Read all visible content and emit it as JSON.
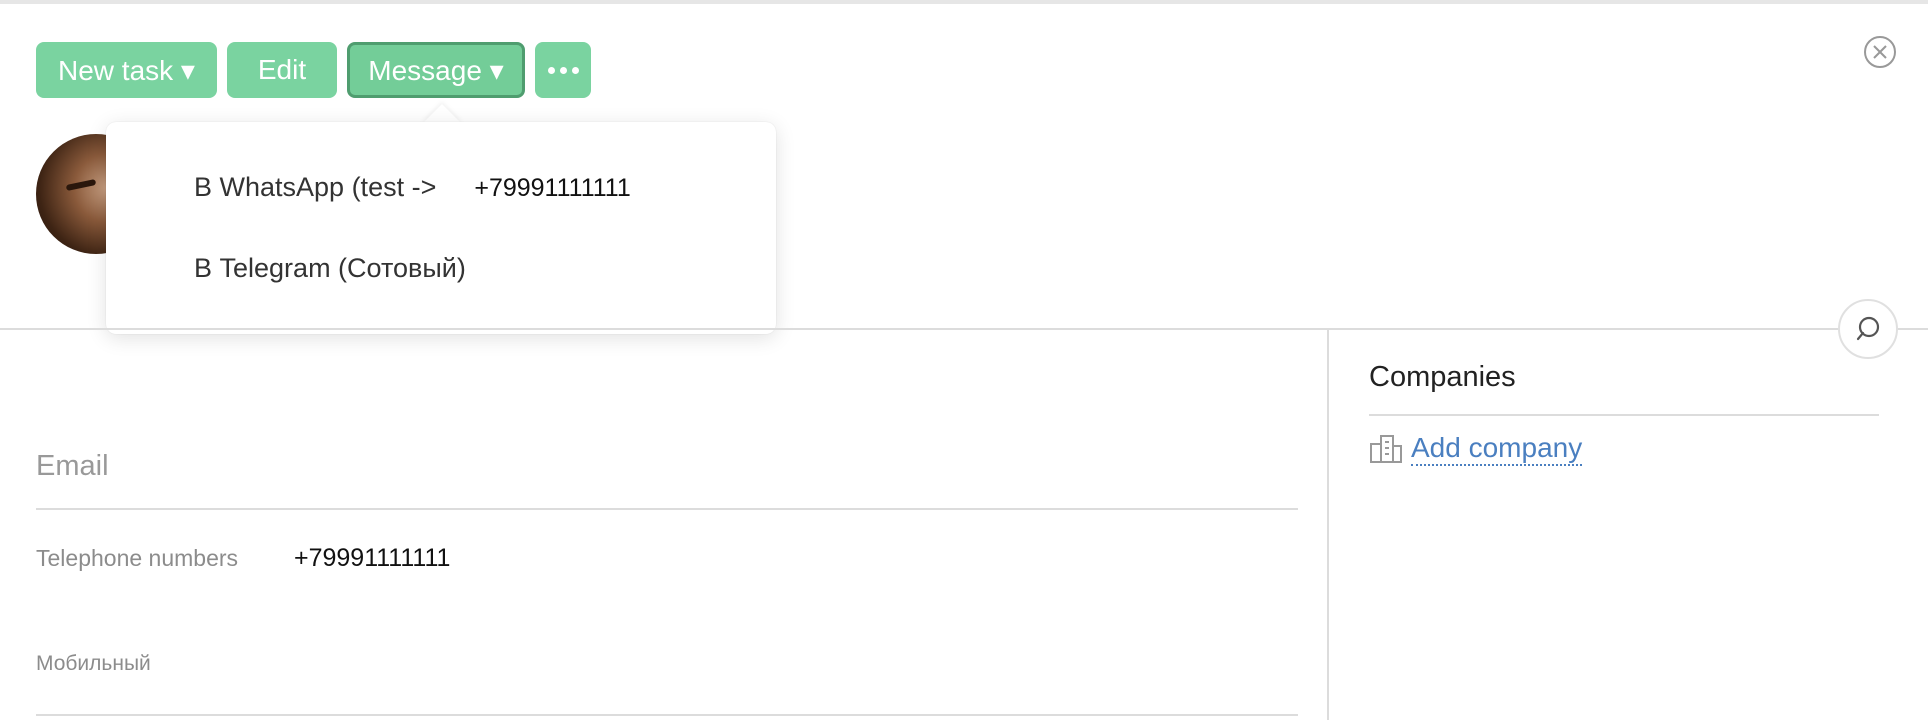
{
  "toolbar": {
    "new_task": "New task ▾",
    "edit": "Edit",
    "message": "Message ▾"
  },
  "message_menu": {
    "items": [
      {
        "label": "В WhatsApp (test ->",
        "phone": "+79991111111"
      },
      {
        "label": "В Telegram (Сотовый)"
      }
    ]
  },
  "contact": {
    "email_label": "Email",
    "telephone_label": "Telephone numbers",
    "telephone_value": "+79991111111",
    "mobile_label": "Мобильный"
  },
  "companies": {
    "title": "Companies",
    "add_label": "Add company"
  },
  "icons": {
    "close": "close-circle-icon",
    "chat": "chat-bubble-icon",
    "company": "building-icon",
    "more": "ellipsis-icon"
  },
  "colors": {
    "button_green": "#7ad3a0",
    "link_blue": "#4a7fc0"
  }
}
